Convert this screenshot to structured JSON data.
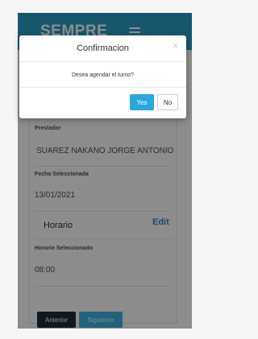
{
  "app": {
    "brand": "SEMPRE"
  },
  "form": {
    "prestador_label": "Prestador",
    "prestador_value": "SUAREZ NAKANO JORGE ANTONIO",
    "fecha_label": "Fecha Seleccionada",
    "fecha_value": "13/01/2021",
    "horario_title": "Horario",
    "edit_label": "Edit",
    "horario_sel_label": "Horario Seleccionado",
    "horario_sel_value": "08:00",
    "anterior_label": "Anterior",
    "siguiente_label": "Siguiente"
  },
  "modal": {
    "title": "Confirmacion",
    "close_glyph": "×",
    "message": "Desea agendar el turno?",
    "yes_label": "Yes",
    "no_label": "No"
  },
  "colors": {
    "header": "#2a9fc6",
    "primary_button": "#2aa8de",
    "dark_button": "#1f2d3a"
  }
}
